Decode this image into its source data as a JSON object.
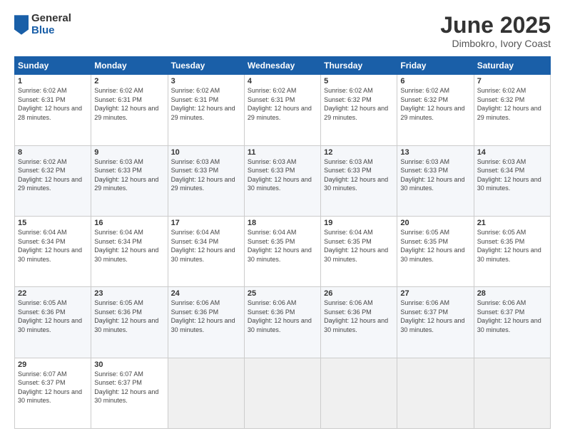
{
  "header": {
    "logo_general": "General",
    "logo_blue": "Blue",
    "month_title": "June 2025",
    "subtitle": "Dimbokro, Ivory Coast"
  },
  "weekdays": [
    "Sunday",
    "Monday",
    "Tuesday",
    "Wednesday",
    "Thursday",
    "Friday",
    "Saturday"
  ],
  "weeks": [
    [
      {
        "day": "1",
        "sunrise": "6:02 AM",
        "sunset": "6:31 PM",
        "daylight": "12 hours and 28 minutes."
      },
      {
        "day": "2",
        "sunrise": "6:02 AM",
        "sunset": "6:31 PM",
        "daylight": "12 hours and 29 minutes."
      },
      {
        "day": "3",
        "sunrise": "6:02 AM",
        "sunset": "6:31 PM",
        "daylight": "12 hours and 29 minutes."
      },
      {
        "day": "4",
        "sunrise": "6:02 AM",
        "sunset": "6:31 PM",
        "daylight": "12 hours and 29 minutes."
      },
      {
        "day": "5",
        "sunrise": "6:02 AM",
        "sunset": "6:32 PM",
        "daylight": "12 hours and 29 minutes."
      },
      {
        "day": "6",
        "sunrise": "6:02 AM",
        "sunset": "6:32 PM",
        "daylight": "12 hours and 29 minutes."
      },
      {
        "day": "7",
        "sunrise": "6:02 AM",
        "sunset": "6:32 PM",
        "daylight": "12 hours and 29 minutes."
      }
    ],
    [
      {
        "day": "8",
        "sunrise": "6:02 AM",
        "sunset": "6:32 PM",
        "daylight": "12 hours and 29 minutes."
      },
      {
        "day": "9",
        "sunrise": "6:03 AM",
        "sunset": "6:33 PM",
        "daylight": "12 hours and 29 minutes."
      },
      {
        "day": "10",
        "sunrise": "6:03 AM",
        "sunset": "6:33 PM",
        "daylight": "12 hours and 29 minutes."
      },
      {
        "day": "11",
        "sunrise": "6:03 AM",
        "sunset": "6:33 PM",
        "daylight": "12 hours and 30 minutes."
      },
      {
        "day": "12",
        "sunrise": "6:03 AM",
        "sunset": "6:33 PM",
        "daylight": "12 hours and 30 minutes."
      },
      {
        "day": "13",
        "sunrise": "6:03 AM",
        "sunset": "6:33 PM",
        "daylight": "12 hours and 30 minutes."
      },
      {
        "day": "14",
        "sunrise": "6:03 AM",
        "sunset": "6:34 PM",
        "daylight": "12 hours and 30 minutes."
      }
    ],
    [
      {
        "day": "15",
        "sunrise": "6:04 AM",
        "sunset": "6:34 PM",
        "daylight": "12 hours and 30 minutes."
      },
      {
        "day": "16",
        "sunrise": "6:04 AM",
        "sunset": "6:34 PM",
        "daylight": "12 hours and 30 minutes."
      },
      {
        "day": "17",
        "sunrise": "6:04 AM",
        "sunset": "6:34 PM",
        "daylight": "12 hours and 30 minutes."
      },
      {
        "day": "18",
        "sunrise": "6:04 AM",
        "sunset": "6:35 PM",
        "daylight": "12 hours and 30 minutes."
      },
      {
        "day": "19",
        "sunrise": "6:04 AM",
        "sunset": "6:35 PM",
        "daylight": "12 hours and 30 minutes."
      },
      {
        "day": "20",
        "sunrise": "6:05 AM",
        "sunset": "6:35 PM",
        "daylight": "12 hours and 30 minutes."
      },
      {
        "day": "21",
        "sunrise": "6:05 AM",
        "sunset": "6:35 PM",
        "daylight": "12 hours and 30 minutes."
      }
    ],
    [
      {
        "day": "22",
        "sunrise": "6:05 AM",
        "sunset": "6:36 PM",
        "daylight": "12 hours and 30 minutes."
      },
      {
        "day": "23",
        "sunrise": "6:05 AM",
        "sunset": "6:36 PM",
        "daylight": "12 hours and 30 minutes."
      },
      {
        "day": "24",
        "sunrise": "6:06 AM",
        "sunset": "6:36 PM",
        "daylight": "12 hours and 30 minutes."
      },
      {
        "day": "25",
        "sunrise": "6:06 AM",
        "sunset": "6:36 PM",
        "daylight": "12 hours and 30 minutes."
      },
      {
        "day": "26",
        "sunrise": "6:06 AM",
        "sunset": "6:36 PM",
        "daylight": "12 hours and 30 minutes."
      },
      {
        "day": "27",
        "sunrise": "6:06 AM",
        "sunset": "6:37 PM",
        "daylight": "12 hours and 30 minutes."
      },
      {
        "day": "28",
        "sunrise": "6:06 AM",
        "sunset": "6:37 PM",
        "daylight": "12 hours and 30 minutes."
      }
    ],
    [
      {
        "day": "29",
        "sunrise": "6:07 AM",
        "sunset": "6:37 PM",
        "daylight": "12 hours and 30 minutes."
      },
      {
        "day": "30",
        "sunrise": "6:07 AM",
        "sunset": "6:37 PM",
        "daylight": "12 hours and 30 minutes."
      },
      null,
      null,
      null,
      null,
      null
    ]
  ],
  "labels": {
    "sunrise": "Sunrise:",
    "sunset": "Sunset:",
    "daylight": "Daylight:"
  }
}
